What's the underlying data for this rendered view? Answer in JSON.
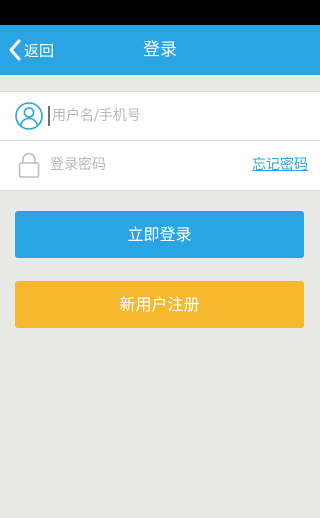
{
  "nav": {
    "back_label": "返回",
    "title": "登录"
  },
  "form": {
    "username_placeholder": "用户名/手机号",
    "username_value": "",
    "password_placeholder": "登录密码",
    "password_value": "",
    "forgot_label": "忘记密码"
  },
  "actions": {
    "login_label": "立即登录",
    "register_label": "新用户注册"
  },
  "icons": {
    "back": "chevron-left-icon",
    "user": "user-icon",
    "lock": "lock-icon"
  },
  "colors": {
    "primary": "#2aa4e3",
    "secondary": "#f6b82e",
    "background": "#e9e9e6"
  }
}
